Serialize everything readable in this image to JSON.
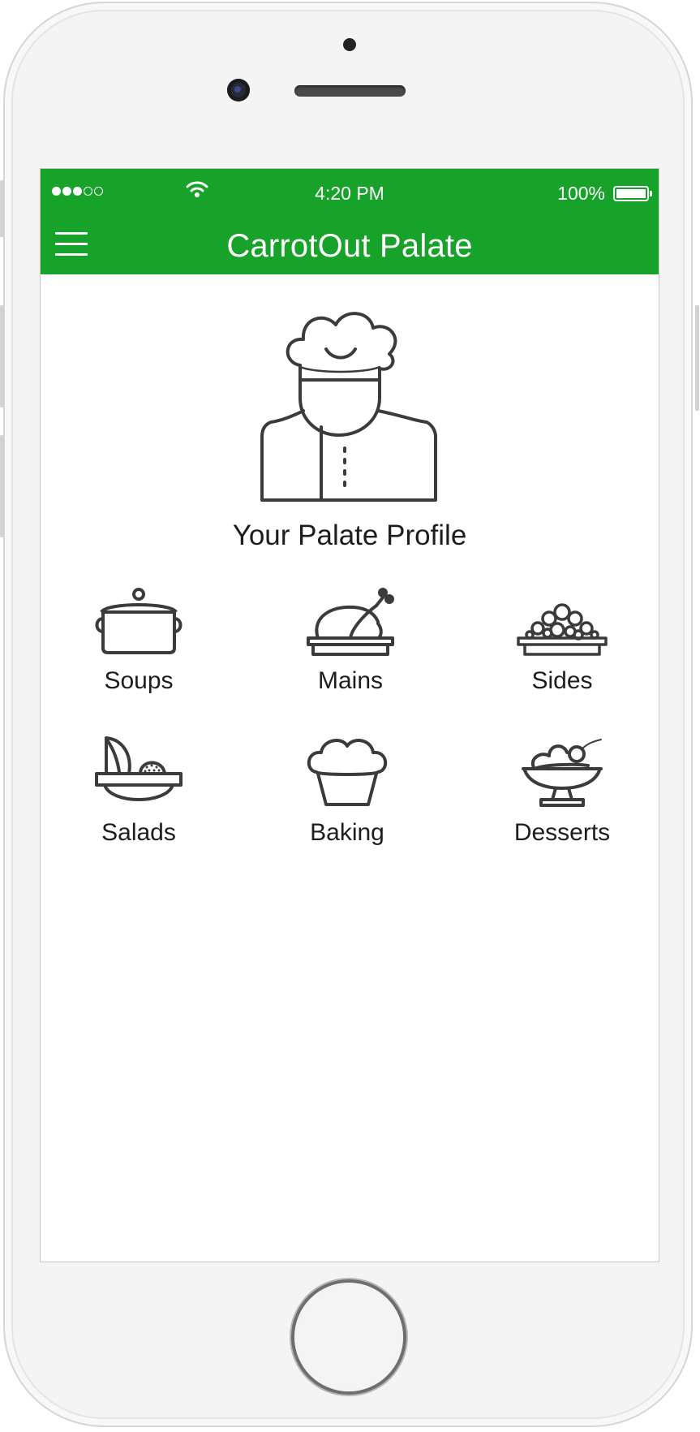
{
  "status_bar": {
    "time": "4:20 PM",
    "battery_percent": "100%",
    "signal_bars_filled": 3,
    "signal_bars_total": 5,
    "wifi_icon": "wifi-icon",
    "battery_icon": "battery-full-icon"
  },
  "navbar": {
    "title": "CarrotOut Palate",
    "menu_icon": "hamburger-menu-icon",
    "background_color": "#17a329",
    "text_color": "#ffffff"
  },
  "profile": {
    "avatar_icon": "chef-icon",
    "title": "Your Palate Profile"
  },
  "categories": [
    {
      "label": "Soups",
      "icon": "soup-pot-icon"
    },
    {
      "label": "Mains",
      "icon": "roast-chicken-icon"
    },
    {
      "label": "Sides",
      "icon": "side-dish-icon"
    },
    {
      "label": "Salads",
      "icon": "salad-bowl-icon"
    },
    {
      "label": "Baking",
      "icon": "muffin-icon"
    },
    {
      "label": "Desserts",
      "icon": "dessert-cup-icon"
    }
  ],
  "colors": {
    "accent": "#17a329",
    "icon_stroke": "#3b3b3b",
    "text": "#1d1d1d"
  }
}
